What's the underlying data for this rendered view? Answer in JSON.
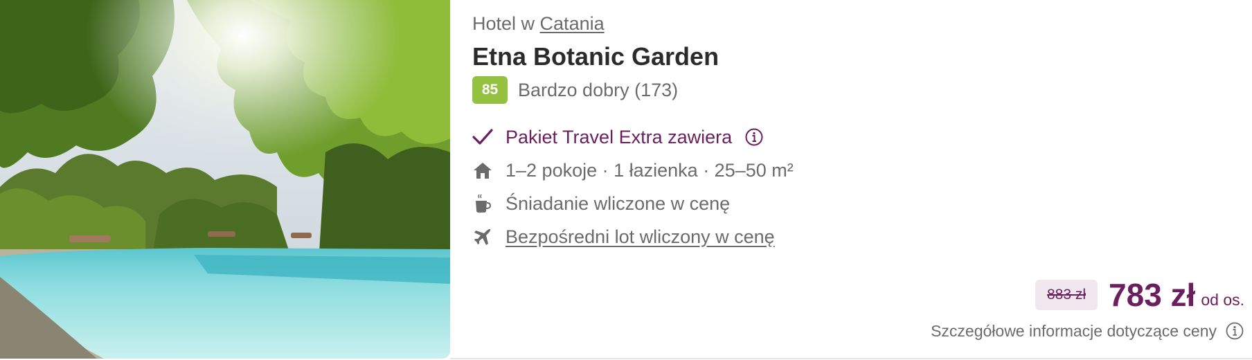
{
  "hotel": {
    "location_prefix": "Hotel w",
    "location_link": "Catania",
    "name": "Etna Botanic Garden",
    "rating": {
      "score": "85",
      "label": "Bardzo dobry (173)",
      "badge_color": "#94c13f"
    }
  },
  "features": [
    {
      "icon": "check-icon",
      "label": "Pakiet Travel Extra zawiera",
      "info_icon": "info-icon"
    },
    {
      "icon": "house-icon",
      "label": "1–2 pokoje · 1 łazienka · 25–50 m²"
    },
    {
      "icon": "coffee-cup-icon",
      "label": "Śniadanie wliczone w cenę"
    },
    {
      "icon": "airplane-icon",
      "label": "Bezpośredni lot wliczony w cenę"
    }
  ],
  "price": {
    "old": "883 zł",
    "current": "783 zł",
    "per_person": "od os.",
    "details_link": "Szczegółowe informacje dotyczące ceny",
    "accent_color": "#6a1f5e"
  },
  "photo": {
    "icon": "hotel-pool-photo"
  }
}
